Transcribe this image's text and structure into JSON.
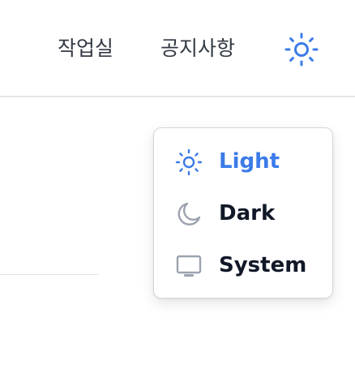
{
  "header": {
    "nav": {
      "workroom_label": "작업실",
      "notice_label": "공지사항"
    },
    "theme_toggle": {
      "icon": "sun-icon",
      "active": "Light"
    }
  },
  "theme_menu": {
    "items": [
      {
        "label": "Light",
        "icon": "sun-icon",
        "selected": true
      },
      {
        "label": "Dark",
        "icon": "moon-icon",
        "selected": false
      },
      {
        "label": "System",
        "icon": "monitor-icon",
        "selected": false
      }
    ]
  },
  "colors": {
    "accent": "#3b7be8",
    "text": "#111827",
    "nav_text": "#333a44",
    "icon_muted": "#9ca3af",
    "border": "#d6d6d9"
  }
}
